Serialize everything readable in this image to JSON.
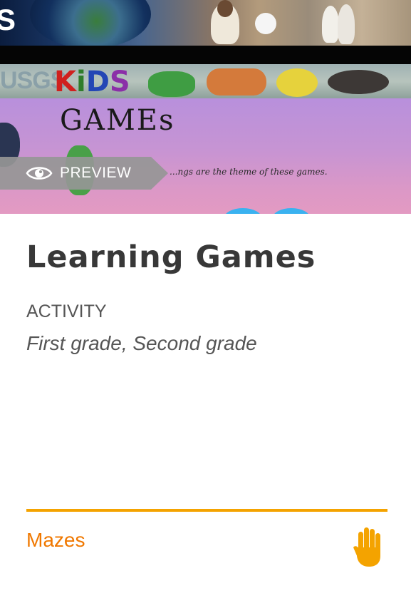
{
  "card": {
    "thumbnail": {
      "banner": {
        "usgs": "USGS",
        "kids": [
          "K",
          "i",
          "D",
          "S"
        ],
        "games": "GAMEs",
        "caption": "...ngs are the theme of these games."
      },
      "preview": {
        "label": "PREVIEW",
        "icon": "eye-icon"
      }
    },
    "title": "Learning Games",
    "resource_type": "ACTIVITY",
    "grades": "First grade, Second grade",
    "footer": {
      "topic": "Mazes",
      "icon": "hand-icon",
      "accent_color": "#f4a300",
      "link_color": "#f07800"
    }
  }
}
